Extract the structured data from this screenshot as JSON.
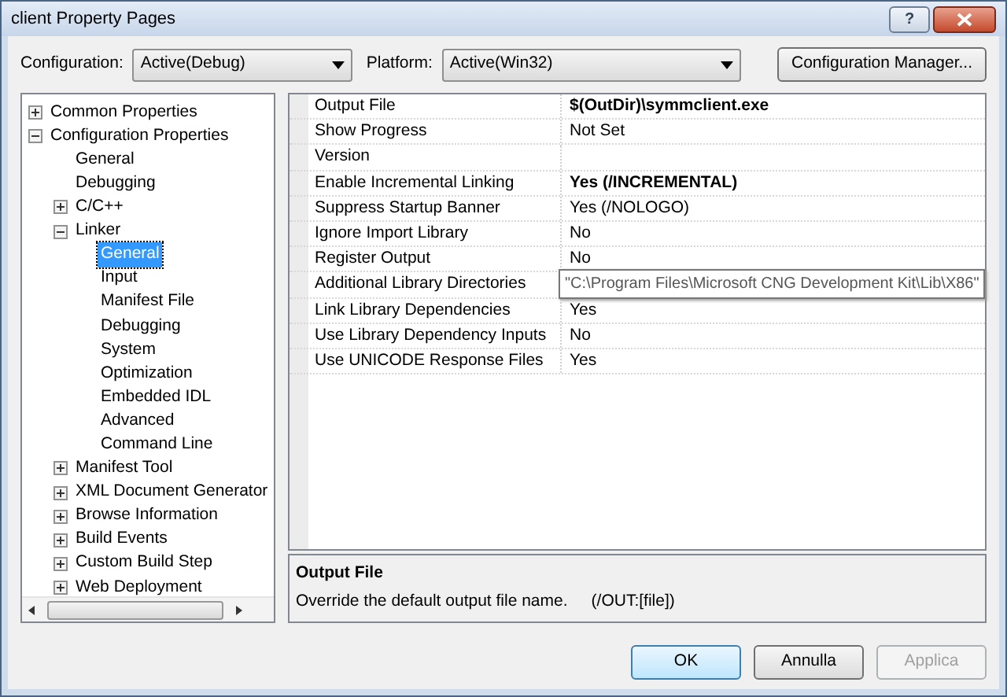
{
  "window": {
    "title": "client Property Pages",
    "help": "?"
  },
  "toolbar": {
    "configuration_label": "Configuration:",
    "configuration_value": "Active(Debug)",
    "platform_label": "Platform:",
    "platform_value": "Active(Win32)",
    "manager_button": "Configuration Manager..."
  },
  "tree": [
    {
      "label": "Common Properties",
      "expanded": false,
      "selected": false
    },
    {
      "label": "Configuration Properties",
      "expanded": true,
      "selected": false,
      "children": [
        {
          "label": "General",
          "selected": false
        },
        {
          "label": "Debugging",
          "selected": false
        },
        {
          "label": "C/C++",
          "expanded": false,
          "selected": false
        },
        {
          "label": "Linker",
          "expanded": true,
          "selected": false,
          "children": [
            {
              "label": "General",
              "selected": true
            },
            {
              "label": "Input",
              "selected": false
            },
            {
              "label": "Manifest File",
              "selected": false
            },
            {
              "label": "Debugging",
              "selected": false
            },
            {
              "label": "System",
              "selected": false
            },
            {
              "label": "Optimization",
              "selected": false
            },
            {
              "label": "Embedded IDL",
              "selected": false
            },
            {
              "label": "Advanced",
              "selected": false
            },
            {
              "label": "Command Line",
              "selected": false
            }
          ]
        },
        {
          "label": "Manifest Tool",
          "expanded": false,
          "selected": false
        },
        {
          "label": "XML Document Generator",
          "expanded": false,
          "selected": false
        },
        {
          "label": "Browse Information",
          "expanded": false,
          "selected": false
        },
        {
          "label": "Build Events",
          "expanded": false,
          "selected": false
        },
        {
          "label": "Custom Build Step",
          "expanded": false,
          "selected": false
        },
        {
          "label": "Web Deployment",
          "expanded": false,
          "selected": false
        }
      ]
    }
  ],
  "properties": [
    {
      "name": "Output File",
      "value": "$(OutDir)\\symmclient.exe",
      "bold": true,
      "tooltip": false
    },
    {
      "name": "Show Progress",
      "value": "Not Set",
      "bold": false,
      "tooltip": false
    },
    {
      "name": "Version"
    },
    {
      "name": "Enable Incremental Linking",
      "value": "Yes (/INCREMENTAL)",
      "bold": true,
      "tooltip": false
    },
    {
      "name": "Suppress Startup Banner",
      "value": "Yes (/NOLOGO)",
      "bold": false,
      "tooltip": false
    },
    {
      "name": "Ignore Import Library",
      "value": "No",
      "bold": false,
      "tooltip": false
    },
    {
      "name": "Register Output",
      "value": "No",
      "bold": false,
      "tooltip": false
    },
    {
      "name": "Additional Library Directories",
      "value": "\"C:\\Program Files\\Microsoft CNG Development Kit\\Lib\\X86\"",
      "bold": false,
      "tooltip": true
    },
    {
      "name": "Link Library Dependencies",
      "value": "Yes",
      "bold": false,
      "tooltip": false
    },
    {
      "name": "Use Library Dependency Inputs",
      "value": "No",
      "bold": false,
      "tooltip": false
    },
    {
      "name": "Use UNICODE Response Files",
      "value": "Yes",
      "bold": false,
      "tooltip": false
    }
  ],
  "description": {
    "title": "Output File",
    "text": "Override the default output file name.",
    "switch": "(/OUT:[file])"
  },
  "buttons": [
    {
      "label": "OK",
      "default": true,
      "disabled": false
    },
    {
      "label": "Annulla",
      "default": false,
      "disabled": false
    },
    {
      "label": "Applica",
      "default": false,
      "disabled": true
    }
  ]
}
